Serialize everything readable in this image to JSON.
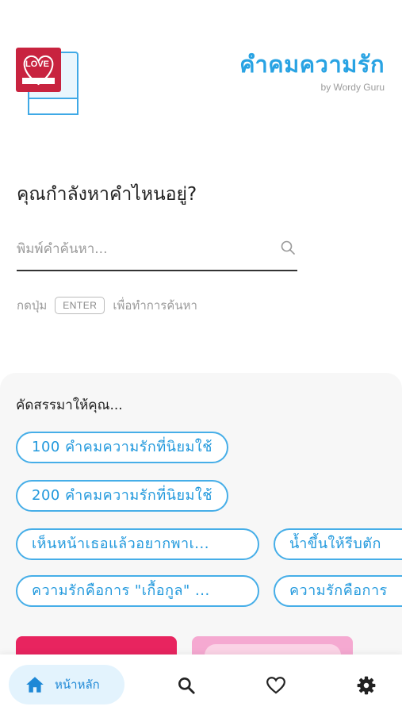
{
  "header": {
    "title": "คำคมความรัก",
    "subtitle": "by Wordy Guru",
    "logo_text": "LOVE"
  },
  "search": {
    "heading": "คุณกำลังหาคำไหนอยู่?",
    "placeholder": "พิมพ์คำค้นหา...",
    "hint_before": "กดปุ่ม",
    "hint_key": "ENTER",
    "hint_after": "เพื่อทำการค้นหา"
  },
  "suggestions": {
    "title": "คัดสรรมาให้คุณ...",
    "chips": [
      "100 คำคมความรักที่นิยมใช้",
      "200 คำคมความรักที่นิยมใช้",
      "เห็นหน้าเธอแล้วอยากพาเ...",
      "น้ำขึ้นให้รีบตัก",
      "ความรักคือการ \"เกื้อกูล\" ...",
      "ความรักคือการ"
    ]
  },
  "nav": {
    "home_label": "หน้าหลัก"
  },
  "colors": {
    "accent": "#29a3e3",
    "chip_border": "#46aee8",
    "nav_active_bg": "#e3f3fd",
    "logo_red": "#c8233f",
    "card_red": "#e8245f",
    "card_pink": "#f5a9d1"
  }
}
